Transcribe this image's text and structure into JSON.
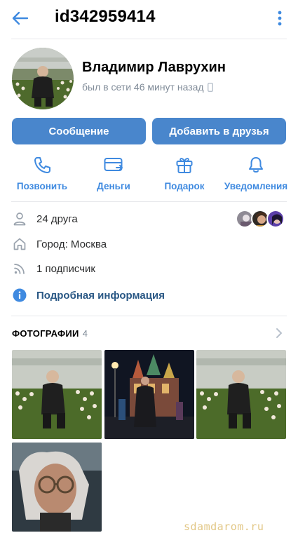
{
  "header": {
    "title": "id342959414"
  },
  "profile": {
    "name": "Владимир Лаврухин",
    "status": "был в сети 46 минут назад"
  },
  "buttons": {
    "message": "Сообщение",
    "add_friend": "Добавить в друзья"
  },
  "actions": [
    {
      "label": "Позвонить",
      "icon": "phone-icon"
    },
    {
      "label": "Деньги",
      "icon": "money-icon"
    },
    {
      "label": "Подарок",
      "icon": "gift-icon"
    },
    {
      "label": "Уведомления",
      "icon": "bell-icon"
    }
  ],
  "info": {
    "friends": "24 друга",
    "city": "Город: Москва",
    "followers": "1 подписчик",
    "details": "Подробная информация"
  },
  "photos": {
    "title": "ФОТОГРАФИИ",
    "count": "4"
  },
  "watermark": "sdamdarom.ru",
  "colors": {
    "accent": "#4986cc",
    "link": "#3f8ae0",
    "secondary_text": "#818c99"
  }
}
